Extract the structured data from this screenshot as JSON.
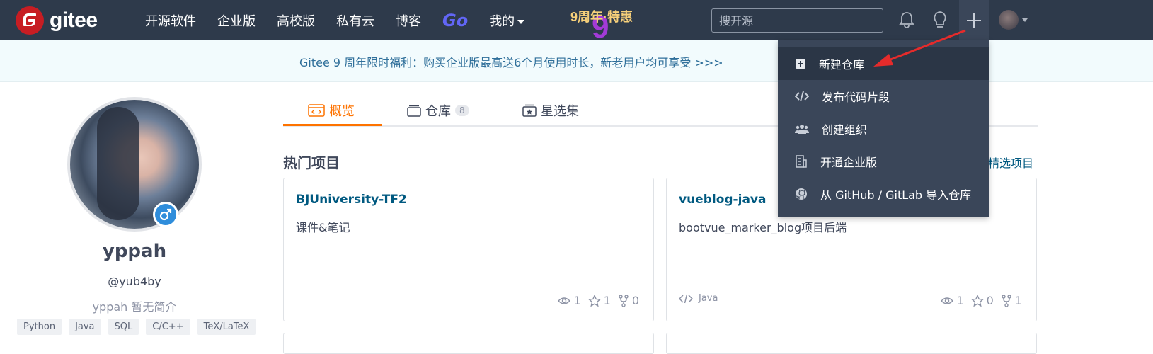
{
  "topbar": {
    "brand": "gitee",
    "nav": [
      {
        "label": "开源软件"
      },
      {
        "label": "企业版"
      },
      {
        "label": "高校版"
      },
      {
        "label": "私有云"
      },
      {
        "label": "博客"
      },
      {
        "label": "Go"
      },
      {
        "label": "我的"
      }
    ],
    "promo": "9周年·特惠",
    "search_placeholder": "搜开源"
  },
  "banner": {
    "text": "Gitee 9 周年限时福利：购买企业版最高送6个月使用时长，新老用户均可享受 >>>"
  },
  "profile": {
    "name": "yppah",
    "handle": "@yub4by",
    "bio": "yppah 暂无简介",
    "tags": [
      "Python",
      "Java",
      "SQL",
      "C/C++",
      "TeX/LaTeX"
    ]
  },
  "tabs": [
    {
      "label": "概览",
      "count": null
    },
    {
      "label": "仓库",
      "count": "8"
    },
    {
      "label": "星选集",
      "count": null
    }
  ],
  "section": {
    "title": "热门项目",
    "more": "精选项目"
  },
  "cards": [
    {
      "title": "BJUniversity-TF2",
      "desc": "课件&笔记",
      "lang": "",
      "watch": "1",
      "star": "1",
      "fork": "0"
    },
    {
      "title": "vueblog-java",
      "desc": "bootvue_marker_blog项目后端",
      "lang": "Java",
      "watch": "1",
      "star": "0",
      "fork": "1"
    }
  ],
  "dropdown": [
    {
      "label": "新建仓库",
      "icon": "plus-square-icon"
    },
    {
      "label": "发布代码片段",
      "icon": "code-icon"
    },
    {
      "label": "创建组织",
      "icon": "group-icon"
    },
    {
      "label": "开通企业版",
      "icon": "building-icon"
    },
    {
      "label": "从 GitHub / GitLab 导入仓库",
      "icon": "github-icon"
    }
  ],
  "colors": {
    "topbar": "#2e3a4b",
    "accent": "#fe7300",
    "link": "#005980",
    "dropdown": "#3a4659",
    "arrow": "#e52b2b"
  }
}
